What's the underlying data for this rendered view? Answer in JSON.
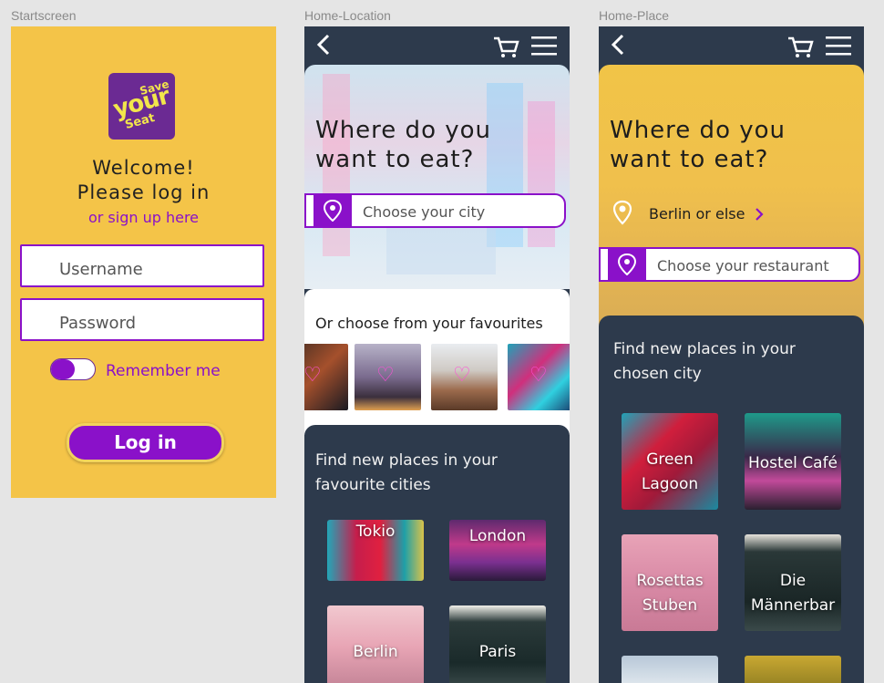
{
  "frames": {
    "start_label": "Startscreen",
    "homeloc_label": "Home-Location",
    "homeplace_label": "Home-Place"
  },
  "start": {
    "logo_text": [
      "Save",
      "your",
      "Seat"
    ],
    "welcome_line1": "Welcome!",
    "welcome_line2": "Please log in",
    "signup_link": "or sign up here",
    "username_placeholder": "Username",
    "password_placeholder": "Password",
    "remember_label": "Remember me",
    "login_button": "Log in"
  },
  "home_location": {
    "title_line1": "Where do you",
    "title_line2": "want to eat?",
    "search_placeholder": "Choose your city",
    "favourites_title": "Or choose from your favourites",
    "find_line1": "Find new places in your",
    "find_line2": "favourite cities",
    "cities": [
      "Tokio",
      "London",
      "Berlin",
      "Paris"
    ]
  },
  "home_place": {
    "title_line1": "Where do you",
    "title_line2": "want to eat?",
    "location_text": "Berlin or else",
    "search_placeholder": "Choose your restaurant",
    "find_line1": "Find new places in your",
    "find_line2": "chosen city",
    "places": [
      {
        "line1": "Green",
        "line2": "Lagoon"
      },
      {
        "line1": "Hostel Café",
        "line2": ""
      },
      {
        "line1": "Rosettas",
        "line2": "Stuben"
      },
      {
        "line1": "Die",
        "line2": "Männerbar"
      }
    ]
  },
  "colors": {
    "yellow": "#f4c448",
    "purple": "#8a11c9",
    "navy": "#2d3a4c"
  }
}
